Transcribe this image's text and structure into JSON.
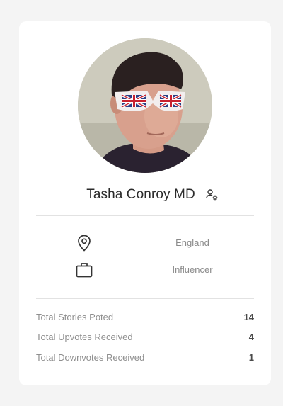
{
  "profile": {
    "name": "Tasha Conroy MD",
    "location": "England",
    "occupation": "Influencer"
  },
  "stats": [
    {
      "label": "Total Stories Poted",
      "value": "14"
    },
    {
      "label": "Total Upvotes Received",
      "value": "4"
    },
    {
      "label": "Total Downvotes Received",
      "value": "1"
    }
  ],
  "icons": {
    "settings": "user-settings-icon",
    "location": "map-pin-icon",
    "occupation": "briefcase-icon"
  },
  "colors": {
    "card_bg": "#ffffff",
    "page_bg": "#f4f4f4",
    "name_text": "#2b2b2b",
    "muted_text": "#8a8a8a",
    "divider": "#e2e2e2"
  }
}
